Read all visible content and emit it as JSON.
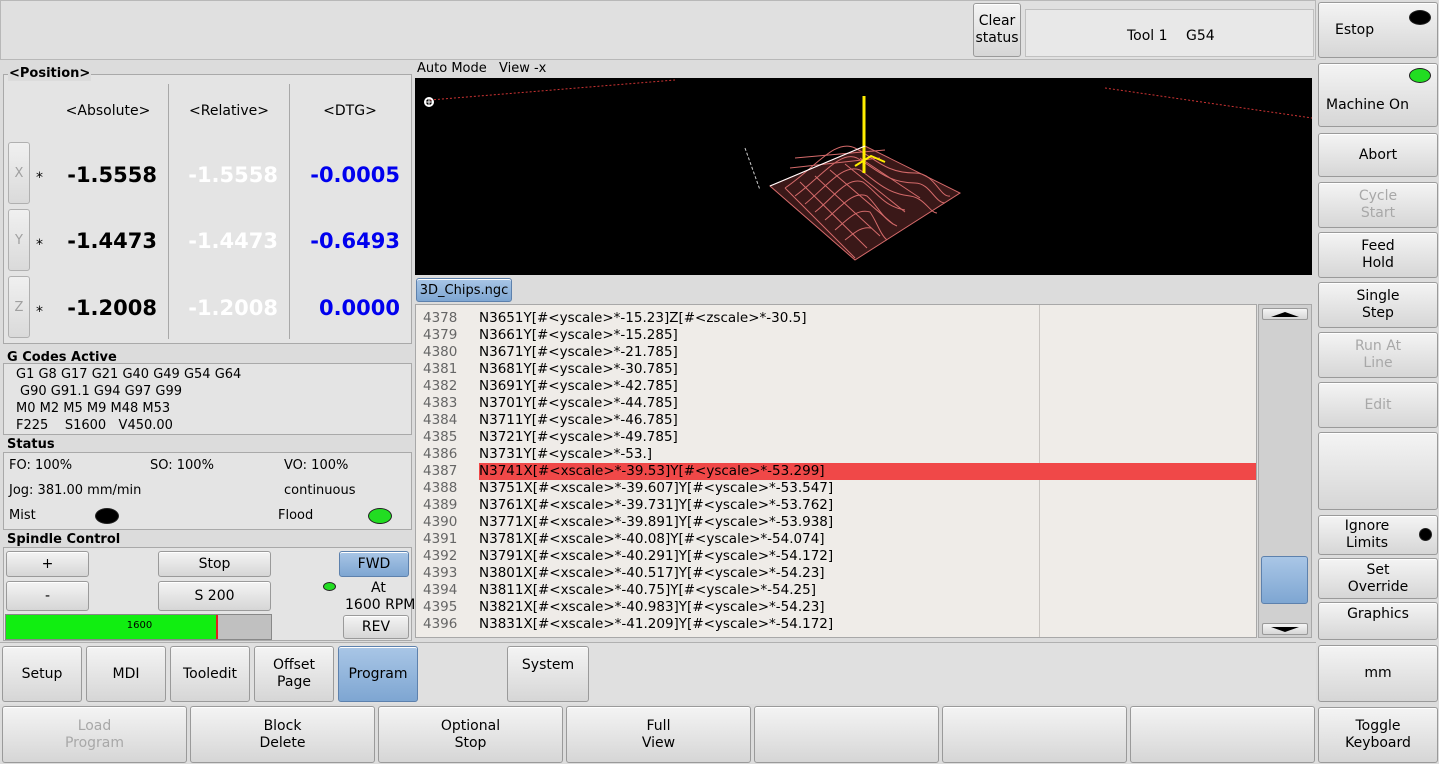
{
  "topbar": {
    "clear_status": "Clear\nstatus",
    "tool": "Tool 1",
    "offset": "G54"
  },
  "right_panel": {
    "estop": "Estop",
    "machine_on": "Machine On",
    "abort": "Abort",
    "cycle_start": "Cycle\nStart",
    "feed_hold": "Feed\nHold",
    "single_step": "Single\nStep",
    "run_at_line": "Run At\nLine",
    "edit": "Edit",
    "ignore_limits": "Ignore\nLimits",
    "set_override": "Set\nOverride",
    "graphics": "Graphics",
    "units": "mm",
    "toggle_keyboard": "Toggle\nKeyboard",
    "colors": {
      "estop_led": "#000000",
      "machine_on_led": "#22dd22"
    }
  },
  "position": {
    "title": "<Position>",
    "headers": {
      "absolute": "<Absolute>",
      "relative": "<Relative>",
      "dtg": "<DTG>"
    },
    "axes": [
      {
        "name": "X",
        "marker": "*",
        "absolute": "-1.5558",
        "relative": "-1.5558",
        "dtg": "-0.0005"
      },
      {
        "name": "Y",
        "marker": "*",
        "absolute": "-1.4473",
        "relative": "-1.4473",
        "dtg": "-0.6493"
      },
      {
        "name": "Z",
        "marker": "*",
        "absolute": "-1.2008",
        "relative": "-1.2008",
        "dtg": "0.0000"
      }
    ]
  },
  "gcodes": {
    "title": "G Codes Active",
    "line1": "G1 G8 G17 G21 G40 G49 G54 G64",
    "line2": "G90 G91.1 G94 G97 G99",
    "line3": "M0 M2 M5 M9 M48 M53",
    "line4": "F225    S1600   V450.00"
  },
  "status": {
    "title": "Status",
    "fo": "FO: 100%",
    "so": "SO: 100%",
    "vo": "VO: 100%",
    "jog": "Jog: 381.00 mm/min",
    "jog_mode": "continuous",
    "mist": "Mist",
    "flood": "Flood"
  },
  "spindle": {
    "title": "Spindle Control",
    "plus": "+",
    "minus": "-",
    "stop": "Stop",
    "speed_btn": "S 200",
    "fwd": "FWD",
    "rev": "REV",
    "at": "At",
    "rpm": "1600 RPM",
    "bar_value": "1600",
    "bar_fraction": 0.8
  },
  "preview": {
    "mode": "Auto Mode",
    "view": "View -x"
  },
  "file": {
    "tab": "3D_Chips.ngc",
    "lines": [
      {
        "n": "4378",
        "code": "N3651Y[#<yscale>*-15.23]Z[#<zscale>*-30.5]"
      },
      {
        "n": "4379",
        "code": "N3661Y[#<yscale>*-15.285]"
      },
      {
        "n": "4380",
        "code": "N3671Y[#<yscale>*-21.785]"
      },
      {
        "n": "4381",
        "code": "N3681Y[#<yscale>*-30.785]"
      },
      {
        "n": "4382",
        "code": "N3691Y[#<yscale>*-42.785]"
      },
      {
        "n": "4383",
        "code": "N3701Y[#<yscale>*-44.785]"
      },
      {
        "n": "4384",
        "code": "N3711Y[#<yscale>*-46.785]"
      },
      {
        "n": "4385",
        "code": "N3721Y[#<yscale>*-49.785]"
      },
      {
        "n": "4386",
        "code": "N3731Y[#<yscale>*-53.]"
      },
      {
        "n": "4387",
        "code": "N3741X[#<xscale>*-39.53]Y[#<yscale>*-53.299]"
      },
      {
        "n": "4388",
        "code": "N3751X[#<xscale>*-39.607]Y[#<yscale>*-53.547]"
      },
      {
        "n": "4389",
        "code": "N3761X[#<xscale>*-39.731]Y[#<yscale>*-53.762]"
      },
      {
        "n": "4390",
        "code": "N3771X[#<xscale>*-39.891]Y[#<yscale>*-53.938]"
      },
      {
        "n": "4391",
        "code": "N3781X[#<xscale>*-40.08]Y[#<yscale>*-54.074]"
      },
      {
        "n": "4392",
        "code": "N3791X[#<xscale>*-40.291]Y[#<yscale>*-54.172]"
      },
      {
        "n": "4393",
        "code": "N3801X[#<xscale>*-40.517]Y[#<yscale>*-54.23]"
      },
      {
        "n": "4394",
        "code": "N3811X[#<xscale>*-40.75]Y[#<yscale>*-54.25]"
      },
      {
        "n": "4395",
        "code": "N3821X[#<xscale>*-40.983]Y[#<yscale>*-54.23]"
      },
      {
        "n": "4396",
        "code": "N3831X[#<xscale>*-41.209]Y[#<yscale>*-54.172]"
      }
    ],
    "highlight_index": 9
  },
  "bottom_tabs": {
    "setup": "Setup",
    "mdi": "MDI",
    "tooledit": "Tooledit",
    "offset_page": "Offset\nPage",
    "program": "Program",
    "system": "System"
  },
  "bottom_buttons": {
    "load_program": "Load\nProgram",
    "block_delete": "Block\nDelete",
    "optional_stop": "Optional\nStop",
    "full_view": "Full\nView"
  }
}
